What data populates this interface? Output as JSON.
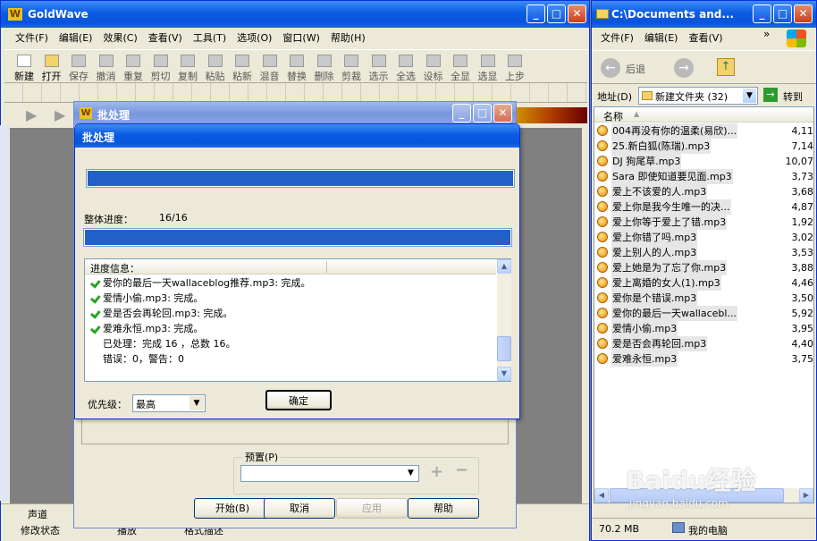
{
  "goldwave": {
    "title": "GoldWave",
    "menu": [
      "文件(F)",
      "编辑(E)",
      "效果(C)",
      "查看(V)",
      "工具(T)",
      "选项(O)",
      "窗口(W)",
      "帮助(H)"
    ],
    "toolbar": [
      "新建",
      "打开",
      "保存",
      "撤消",
      "重复",
      "剪切",
      "复制",
      "粘贴",
      "粘新",
      "混音",
      "替换",
      "删除",
      "剪裁",
      "选示",
      "全选",
      "设标",
      "全显",
      "选显",
      "上步"
    ],
    "status_bottom": [
      "声道",
      "修改状态",
      "播放",
      "格式描述"
    ]
  },
  "batch_outer": {
    "title": "批处理",
    "preset_label": "预置(P)",
    "buttons": {
      "start": "开始(B)",
      "cancel": "取消",
      "apply": "应用",
      "help": "帮助"
    }
  },
  "batch_dialog": {
    "title": "批处理",
    "overall_label": "整体进度：",
    "overall_value": "16/16",
    "file_progress": 1.0,
    "overall_progress": 1.0,
    "info_header": "进度信息：",
    "log": [
      {
        "check": true,
        "text": "爱你的最后一天wallaceblog推荐.mp3: 完成。"
      },
      {
        "check": true,
        "text": "爱情小偷.mp3: 完成。"
      },
      {
        "check": true,
        "text": "爱是否会再轮回.mp3: 完成。"
      },
      {
        "check": true,
        "text": "爱难永恒.mp3: 完成。"
      },
      {
        "check": false,
        "text": "已处理：完成 16 ，总数 16。"
      },
      {
        "check": false,
        "text": "错误：0，警告：0"
      }
    ],
    "priority_label": "优先级：",
    "priority_value": "最高",
    "ok": "确定"
  },
  "explorer": {
    "title": "C:\\Documents and...",
    "menu": [
      "文件(F)",
      "编辑(E)",
      "查看(V)"
    ],
    "back": "后退",
    "address_label": "地址(D)",
    "address_value": "新建文件夹 (32)",
    "go": "转到",
    "column_name": "名称",
    "files": [
      {
        "name": "004再没有你的温柔(易欣)...",
        "size": "4,11"
      },
      {
        "name": "25.新白狐(陈瑞).mp3",
        "size": "7,14"
      },
      {
        "name": "DJ 狗尾草.mp3",
        "size": "10,07"
      },
      {
        "name": "Sara 即使知道要见面.mp3",
        "size": "3,73"
      },
      {
        "name": "爱上不该爱的人.mp3",
        "size": "3,68"
      },
      {
        "name": "爱上你是我今生唯一的决...",
        "size": "4,87"
      },
      {
        "name": "爱上你等于爱上了错.mp3",
        "size": "1,92"
      },
      {
        "name": "爱上你错了吗.mp3",
        "size": "3,02"
      },
      {
        "name": "爱上别人的人.mp3",
        "size": "3,53"
      },
      {
        "name": "爱上她是为了忘了你.mp3",
        "size": "3,88"
      },
      {
        "name": "爱上离婚的女人(1).mp3",
        "size": "4,46"
      },
      {
        "name": "爱你是个错误.mp3",
        "size": "3,50"
      },
      {
        "name": "爱你的最后一天wallacebl...",
        "size": "5,92"
      },
      {
        "name": "爱情小偷.mp3",
        "size": "3,95"
      },
      {
        "name": "爱是否会再轮回.mp3",
        "size": "4,40"
      },
      {
        "name": "爱难永恒.mp3",
        "size": "3,75"
      }
    ],
    "status_size": "70.2 MB",
    "status_location": "我的电脑"
  },
  "watermark": {
    "text": "Baidu经验",
    "sub": "jingyan.baidu.com"
  }
}
